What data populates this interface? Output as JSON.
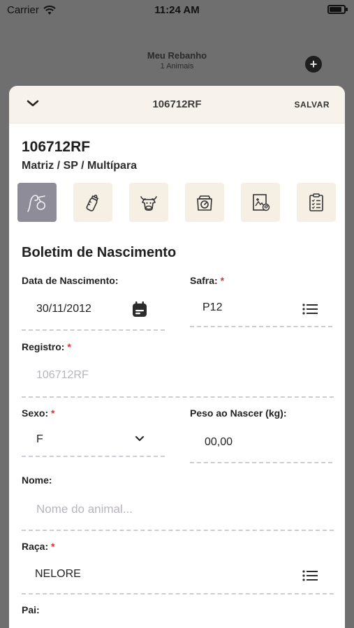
{
  "status_bar": {
    "carrier": "Carrier",
    "time": "11:24 AM"
  },
  "background": {
    "title": "Meu Rebanho",
    "subtitle": "1 Animais"
  },
  "sheet": {
    "title": "106712RF",
    "save_label": "SALVAR",
    "animal_id": "106712RF",
    "animal_desc": "Matriz / SP / Multípara"
  },
  "section": {
    "title": "Boletim de Nascimento"
  },
  "form": {
    "birth_date": {
      "label": "Data de Nascimento:",
      "value": "30/11/2012"
    },
    "safra": {
      "label": "Safra:",
      "value": "P12"
    },
    "registro": {
      "label": "Registro:",
      "value": "106712RF"
    },
    "sexo": {
      "label": "Sexo:",
      "value": "F"
    },
    "peso": {
      "label": "Peso ao Nascer (kg):",
      "value": "00,00"
    },
    "nome": {
      "label": "Nome:",
      "placeholder": "Nome do animal..."
    },
    "raca": {
      "label": "Raça:",
      "value": "NELORE"
    },
    "pai": {
      "label": "Pai:"
    }
  },
  "required_mark": "*",
  "colors": {
    "accent_tab": "#8e8c99",
    "tab_bg": "#f5efe4",
    "required": "#dd3333"
  },
  "battery_level_percent": 85
}
